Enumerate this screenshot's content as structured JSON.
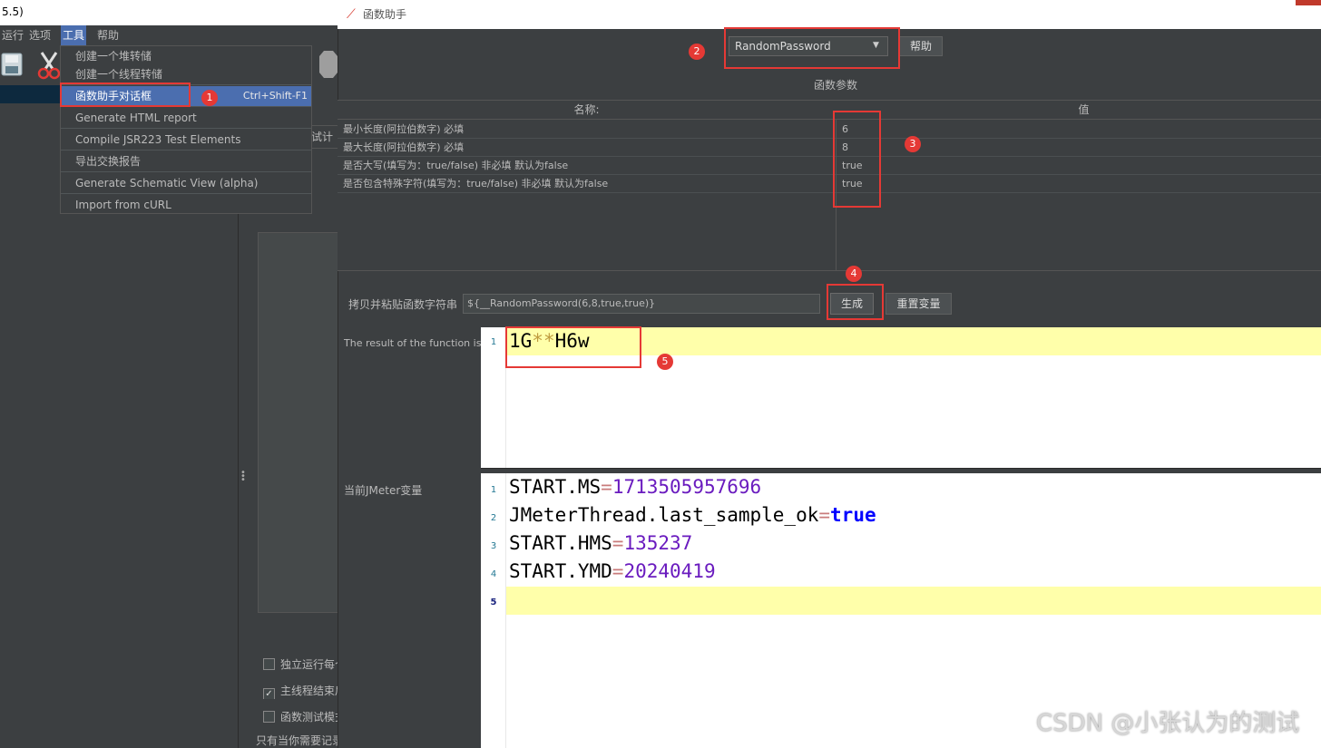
{
  "main_window": {
    "title_fragment": "5.5)",
    "menus": [
      {
        "label": "运行"
      },
      {
        "label": "选项"
      },
      {
        "label": "工具"
      },
      {
        "label": "帮助"
      }
    ],
    "bg_tab_fragment": "试计",
    "checkboxes": [
      {
        "label": "独立运行每个",
        "checked": false
      },
      {
        "label": "主线程结束后",
        "checked": true
      },
      {
        "label": "函数测试模式",
        "checked": false
      }
    ],
    "bottom_text": "只有当你需要记录"
  },
  "tools_menu": {
    "items": [
      {
        "label": "创建一个堆转储",
        "accel": ""
      },
      {
        "label": "创建一个线程转储",
        "accel": ""
      },
      {
        "label": "函数助手对话框",
        "accel": "Ctrl+Shift-F1"
      },
      {
        "label": "Generate HTML report",
        "accel": ""
      },
      {
        "label": "Compile JSR223 Test Elements",
        "accel": ""
      },
      {
        "label": "导出交换报告",
        "accel": ""
      },
      {
        "label": "Generate Schematic View (alpha)",
        "accel": ""
      },
      {
        "label": "Import from cURL",
        "accel": ""
      }
    ]
  },
  "dialog": {
    "title": "函数助手",
    "function_select": "RandomPassword",
    "help_button": "帮助",
    "params_title": "函数参数",
    "table": {
      "headers": [
        "名称:",
        "值"
      ],
      "rows": [
        {
          "name": "最小长度(阿拉伯数字) 必填",
          "value": "6"
        },
        {
          "name": "最大长度(阿拉伯数字) 必填",
          "value": "8"
        },
        {
          "name": "是否大写(填写为：true/false) 非必填 默认为false",
          "value": "true"
        },
        {
          "name": "是否包含特殊字符(填写为：true/false) 非必填 默认为false",
          "value": "true"
        }
      ]
    },
    "copy_label": "拷贝并粘贴函数字符串",
    "function_string": "${__RandomPassword(6,8,true,true)}",
    "generate_button": "生成",
    "reset_button": "重置变量",
    "result_label": "The result of the function is",
    "result": {
      "line_number": "1",
      "part1": "1G",
      "part2": "**",
      "part3": "H6w"
    },
    "vars_label": "当前JMeter变量",
    "vars": [
      {
        "ln": "1",
        "key": "START.MS",
        "eq": "=",
        "val": "1713505957696"
      },
      {
        "ln": "2",
        "key": "JMeterThread.last_sample_ok",
        "eq": "=",
        "val": "true"
      },
      {
        "ln": "3",
        "key": "START.HMS",
        "eq": "=",
        "val": "135237"
      },
      {
        "ln": "4",
        "key": "START.YMD",
        "eq": "=",
        "val": "20240419"
      },
      {
        "ln": "5",
        "key": "",
        "eq": "",
        "val": ""
      }
    ]
  },
  "annotations": {
    "badges": [
      "1",
      "2",
      "3",
      "4",
      "5"
    ]
  },
  "watermark": "CSDN @小张认为的测试",
  "colors": {
    "highlight": "#4b6eaf",
    "annotation_red": "#e53935",
    "editor_current_line": "#ffffaa"
  }
}
